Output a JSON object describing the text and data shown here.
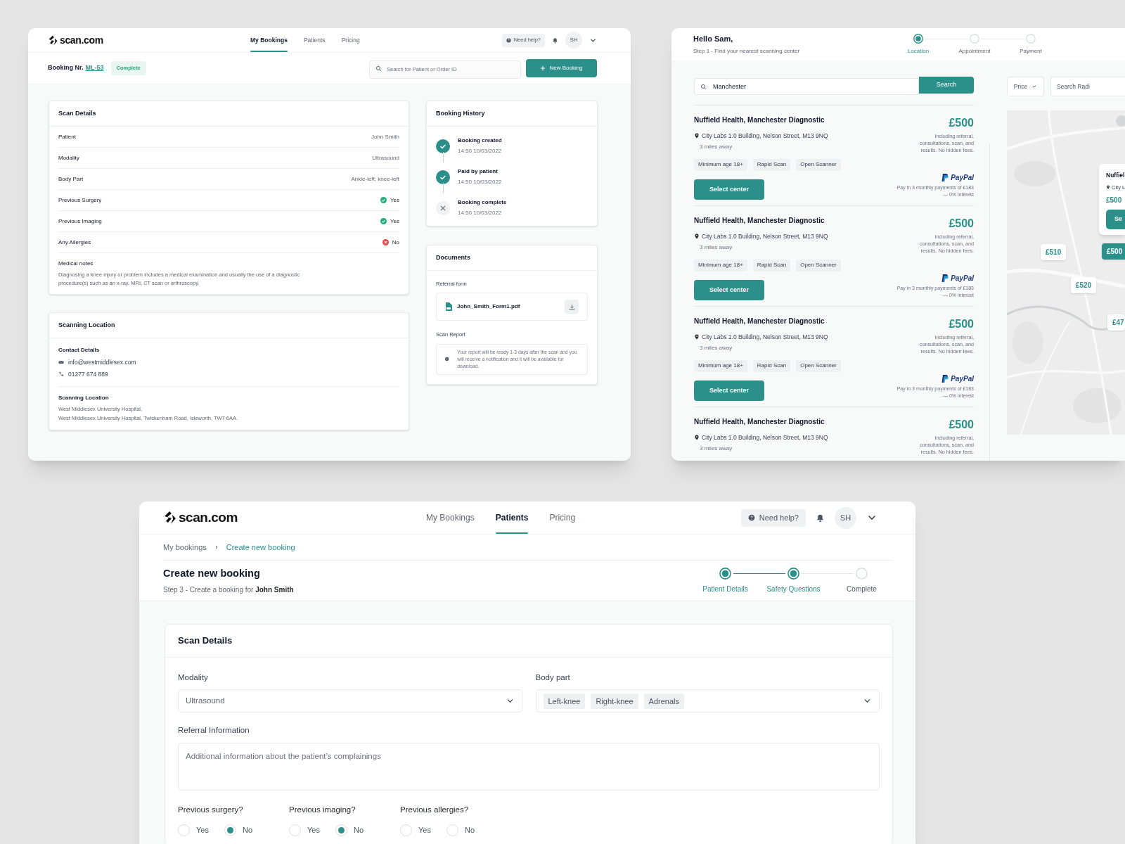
{
  "booking_detail": {
    "logo": "scan.com",
    "nav": [
      {
        "label": "My Bookings",
        "selected": true
      },
      {
        "label": "Patients",
        "selected": false
      },
      {
        "label": "Pricing",
        "selected": false
      }
    ],
    "help": "Need help?",
    "avatar": "SH",
    "booking_label": "Booking Nr.",
    "booking_id": "ML-53",
    "status": "Complete",
    "search": {
      "placeholder": "Search for Patient or Order ID"
    },
    "new_button": "New Booking",
    "scan_details": {
      "title": "Scan Details",
      "rows": [
        {
          "label": "Patient",
          "value": "John Smith",
          "kind": "text"
        },
        {
          "label": "Modality",
          "value": "Ultrasound",
          "kind": "text"
        },
        {
          "label": "Body Part",
          "value": "Ankle-left; knee-left",
          "kind": "text"
        },
        {
          "label": "Previous Surgery",
          "value": "Yes",
          "kind": "yes"
        },
        {
          "label": "Previous Imaging",
          "value": "Yes",
          "kind": "yes"
        },
        {
          "label": "Any Allergies",
          "value": "No",
          "kind": "no"
        }
      ],
      "notes": {
        "label": "Medical notes",
        "text": "Diagnosing a knee injury or problem includes a medical examination and usually the use of a diagnostic procedure(s) such as an x-ray, MRI, CT scan or arthroscopy."
      }
    },
    "scanning_location": {
      "title": "Scanning Location",
      "contact_label": "Contact Details",
      "email": "info@westmiddlesex.com",
      "phone": "01277 674 889",
      "location_label": "Scanning Location",
      "address_lines": [
        "West Middlesex University Hospital,",
        "West Middlesex University Hospital, Twickenham Road, Isleworth, TW7 6AA."
      ]
    },
    "history": {
      "title": "Booking History",
      "events": [
        {
          "title": "Booking created",
          "time": "14:50 10/03/2022",
          "done": true
        },
        {
          "title": "Paid by patient",
          "time": "14:50 10/03/2022",
          "done": true
        },
        {
          "title": "Booking complete",
          "time": "14:50 10/03/2022",
          "done": false
        }
      ]
    },
    "documents": {
      "title": "Documents",
      "referral_label": "Referral form",
      "file_name": "John_Smith_Form1.pdf",
      "report_label": "Scan Report",
      "report_text": "Your report will be ready 1-3 days after the scan and you will receive a notification and it will be available for download."
    }
  },
  "center_search": {
    "greeting": "Hello Sam,",
    "subtitle": "Step 1 - Find your nearest scanning center",
    "steps": [
      {
        "label": "Location",
        "selected": true
      },
      {
        "label": "Appointment",
        "selected": false
      },
      {
        "label": "Payment",
        "selected": false
      }
    ],
    "search": {
      "value": "Manchester",
      "button": "Search"
    },
    "filters": {
      "price": "Price",
      "radius_placeholder": "Search Radi"
    },
    "results": [
      {
        "name": "Nuffield Health, Manchester Diagnostic",
        "address": "City Labs 1.0 Building, Nelson Street, M13 9NQ",
        "distance": "3 miles away",
        "price": "£500",
        "price_note": "Including referral, consultations, scan, and results. No hidden fees.",
        "tags": [
          "Minimum age 18+",
          "Rapid Scan",
          "Open Scanner"
        ],
        "button": "Select center",
        "paypal": "PayPal",
        "paypal_note": "Pay in 3 monthly payments of £183 — 0% interest"
      },
      {
        "name": "Nuffield Health, Manchester Diagnostic",
        "address": "City Labs 1.0 Building, Nelson Street, M13 9NQ",
        "distance": "3 miles away",
        "price": "£500",
        "price_note": "Including referral, consultations, scan, and results. No hidden fees.",
        "tags": [
          "Minimum age 18+",
          "Rapid Scan",
          "Open Scanner"
        ],
        "button": "Select center",
        "paypal": "PayPal",
        "paypal_note": "Pay in 3 monthly payments of £183 — 0% interest"
      },
      {
        "name": "Nuffield Health, Manchester Diagnostic",
        "address": "City Labs 1.0 Building, Nelson Street, M13 9NQ",
        "distance": "3 miles away",
        "price": "£500",
        "price_note": "Including referral, consultations, scan, and results. No hidden fees.",
        "tags": [
          "Minimum age 18+",
          "Rapid Scan",
          "Open Scanner"
        ],
        "button": "Select center",
        "paypal": "PayPal",
        "paypal_note": "Pay in 3 monthly payments of £183 — 0% interest"
      },
      {
        "name": "Nuffield Health, Manchester Diagnostic",
        "address": "City Labs 1.0 Building, Nelson Street, M13 9NQ",
        "distance": "3 miles away",
        "price": "£500",
        "price_note": "Including referral, consultations, scan, and results. No hidden fees."
      }
    ],
    "map": {
      "kind": "picture",
      "popup": {
        "name": "Nuffiel",
        "address": "City L",
        "price": "£500",
        "button": "Se"
      },
      "pins": [
        {
          "label": "£510",
          "selected": false
        },
        {
          "label": "£500",
          "selected": true
        },
        {
          "label": "£520",
          "selected": false
        },
        {
          "label": "£47",
          "selected": false
        }
      ]
    }
  },
  "create_booking": {
    "logo": "scan.com",
    "nav": [
      {
        "label": "My Bookings",
        "selected": false
      },
      {
        "label": "Patients",
        "selected": true
      },
      {
        "label": "Pricing",
        "selected": false
      }
    ],
    "help": "Need help?",
    "avatar": "SH",
    "breadcrumbs": [
      {
        "label": "My bookings",
        "selected": false
      },
      {
        "label": "Create new booking",
        "selected": true
      }
    ],
    "title": "Create new booking",
    "subtitle": "Step 3 - Create a booking for **John Smith**",
    "steps": [
      {
        "label": "Patient Details",
        "reached": true
      },
      {
        "label": "Safety Questions",
        "reached": true
      },
      {
        "label": "Complete",
        "reached": false
      }
    ],
    "card_title": "Scan Details",
    "modality": {
      "label": "Modality",
      "value": "Ultrasound"
    },
    "body_part": {
      "label": "Body part",
      "tags": [
        "Left-knee",
        "Right-knee",
        "Adrenals"
      ]
    },
    "referral": {
      "label": "Referral Information",
      "placeholder": "Additional information about the patient’s complainings"
    },
    "questions": [
      {
        "label": "Previous surgery?",
        "options": [
          {
            "label": "Yes",
            "selected": false
          },
          {
            "label": "No",
            "selected": true
          }
        ]
      },
      {
        "label": "Previous imaging?",
        "options": [
          {
            "label": "Yes",
            "selected": false
          },
          {
            "label": "No",
            "selected": true
          }
        ]
      },
      {
        "label": "Previous allergies?",
        "options": [
          {
            "label": "Yes",
            "selected": false
          },
          {
            "label": "No",
            "selected": false
          }
        ]
      }
    ]
  }
}
